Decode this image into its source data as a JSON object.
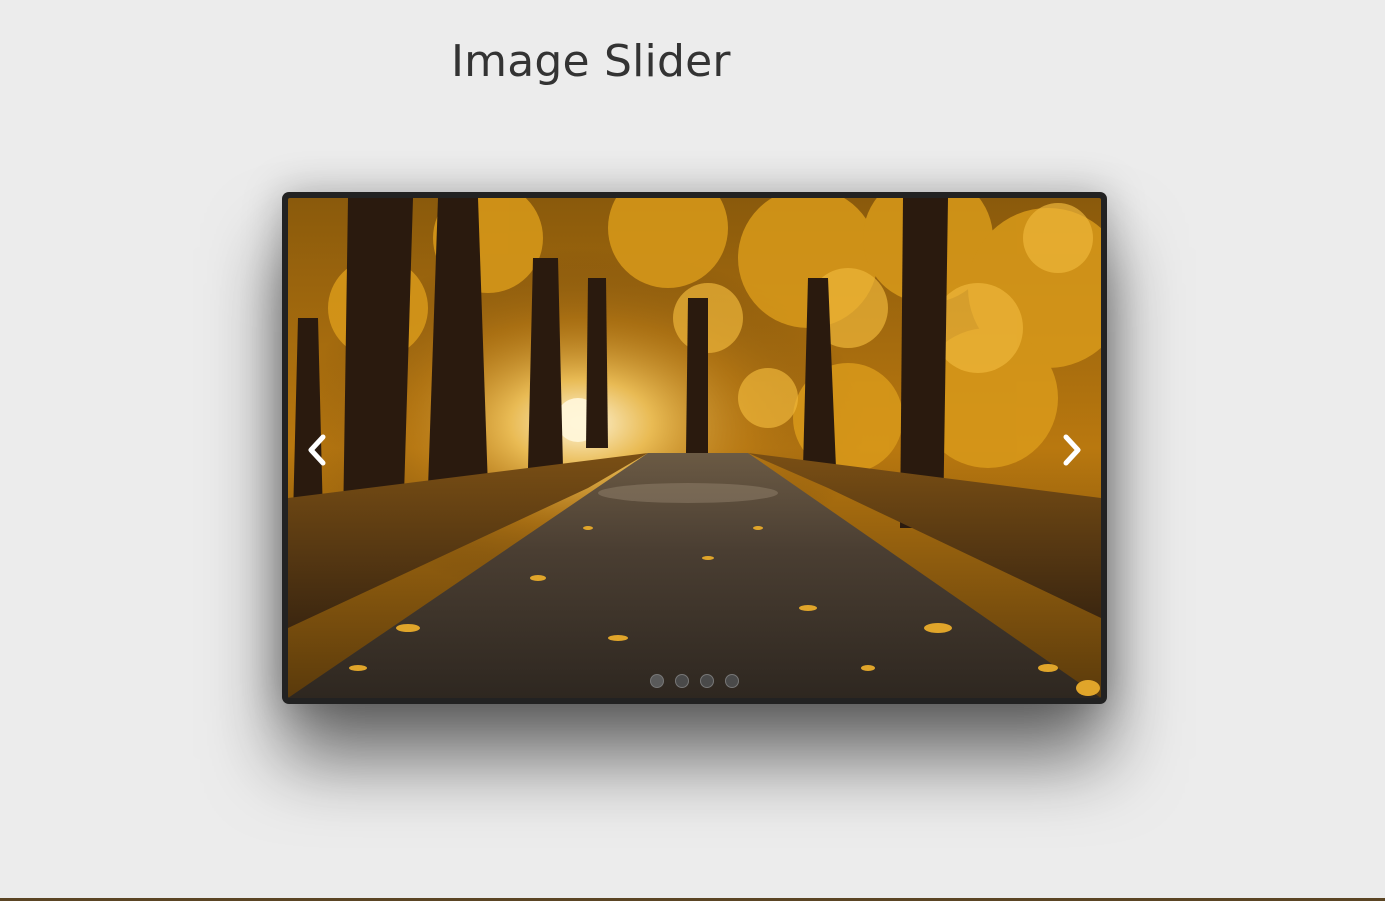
{
  "page": {
    "title": "Image Slider",
    "background": "#ececec",
    "title_color": "#333333"
  },
  "slider": {
    "frame_color": "#222222",
    "current_slide": 1,
    "slide_count": 4,
    "slide_image": "autumn-forest-road",
    "prev_icon": "chevron-left-icon",
    "next_icon": "chevron-right-icon",
    "indicator_dots": [
      "slide-1",
      "slide-2",
      "slide-3",
      "slide-4"
    ]
  },
  "colors": {
    "foliage": "#c98a12",
    "foliage_light": "#e6b030",
    "trunk": "#2a1a0e",
    "road": "#3c342c",
    "sun": "#fff6d8"
  }
}
